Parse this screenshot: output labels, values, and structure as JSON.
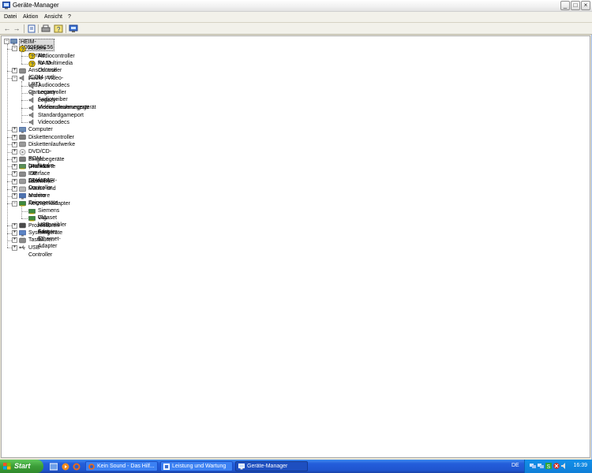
{
  "window": {
    "title": "Geräte-Manager",
    "controls": {
      "minimize": "_",
      "maximize": "□",
      "close": "×"
    }
  },
  "menu": [
    {
      "label": "Datei"
    },
    {
      "label": "Aktion"
    },
    {
      "label": "Ansicht"
    },
    {
      "label": "?"
    }
  ],
  "toolbar": {
    "buttons": [
      "back-icon",
      "forward-icon",
      "properties-icon",
      "print-icon",
      "help-icon",
      "scan-hardware-icon"
    ]
  },
  "tree": {
    "root": "HEIM-A062F98C56",
    "categories": [
      {
        "label": "Andere Geräte",
        "icon": "other-devices-icon",
        "expanded": true,
        "children": [
          {
            "label": "Audiocontroller für Multimedia",
            "icon": "unknown-device-icon"
          },
          {
            "label": "RAID-Controller",
            "icon": "unknown-device-icon"
          }
        ]
      },
      {
        "label": "Anschlüsse (COM und LPT)",
        "icon": "port-icon",
        "expanded": false
      },
      {
        "label": "Audio-, Video- und Gamecontroller",
        "icon": "speaker-icon",
        "expanded": true,
        "children": [
          {
            "label": "Audiocodecs",
            "icon": "speaker-icon"
          },
          {
            "label": "Legacy-Audiotreiber",
            "icon": "speaker-icon"
          },
          {
            "label": "Legacy-Videoaufnahmegerät",
            "icon": "speaker-icon"
          },
          {
            "label": "Mediensteuerungsgerät",
            "icon": "speaker-icon"
          },
          {
            "label": "Standardgameport",
            "icon": "speaker-icon"
          },
          {
            "label": "Videocodecs",
            "icon": "speaker-icon"
          }
        ]
      },
      {
        "label": "Computer",
        "icon": "computer-icon",
        "expanded": false
      },
      {
        "label": "Diskettencontroller",
        "icon": "floppy-controller-icon",
        "expanded": false
      },
      {
        "label": "Diskettenlaufwerke",
        "icon": "floppy-drive-icon",
        "expanded": false
      },
      {
        "label": "DVD/CD-ROM-Laufwerke",
        "icon": "cdrom-icon",
        "expanded": false
      },
      {
        "label": "Eingabegeräte (Human Interface Devices)",
        "icon": "hid-icon",
        "expanded": false
      },
      {
        "label": "Grafikkarte",
        "icon": "display-adapter-icon",
        "expanded": false
      },
      {
        "label": "IDE ATA/ATAPI-Controller",
        "icon": "ide-controller-icon",
        "expanded": false
      },
      {
        "label": "Laufwerke",
        "icon": "disk-drive-icon",
        "expanded": false
      },
      {
        "label": "Mäuse und andere Zeigegeräte",
        "icon": "mouse-icon",
        "expanded": false
      },
      {
        "label": "Monitore",
        "icon": "monitor-icon",
        "expanded": false
      },
      {
        "label": "Netzwerkadapter",
        "icon": "network-adapter-icon",
        "expanded": true,
        "children": [
          {
            "label": "Siemens Gigaset USB Adapter 11",
            "icon": "network-adapter-icon"
          },
          {
            "label": "VIA-kompatibler Fast Ethernet-Adapter",
            "icon": "network-adapter-icon"
          }
        ]
      },
      {
        "label": "Prozessoren",
        "icon": "processor-icon",
        "expanded": false
      },
      {
        "label": "Systemgeräte",
        "icon": "system-devices-icon",
        "expanded": false
      },
      {
        "label": "Tastaturen",
        "icon": "keyboard-icon",
        "expanded": false
      },
      {
        "label": "USB-Controller",
        "icon": "usb-icon",
        "expanded": false
      }
    ]
  },
  "taskbar": {
    "start_label": "Start",
    "tasks": [
      {
        "label": "Kein Sound - Das Hilf...",
        "icon": "firefox-icon",
        "active": false
      },
      {
        "label": "Leistung und Wartung",
        "icon": "control-panel-icon",
        "active": false
      },
      {
        "label": "Geräte-Manager",
        "icon": "device-manager-icon",
        "active": true
      }
    ],
    "language": "DE",
    "clock": "16:39"
  }
}
